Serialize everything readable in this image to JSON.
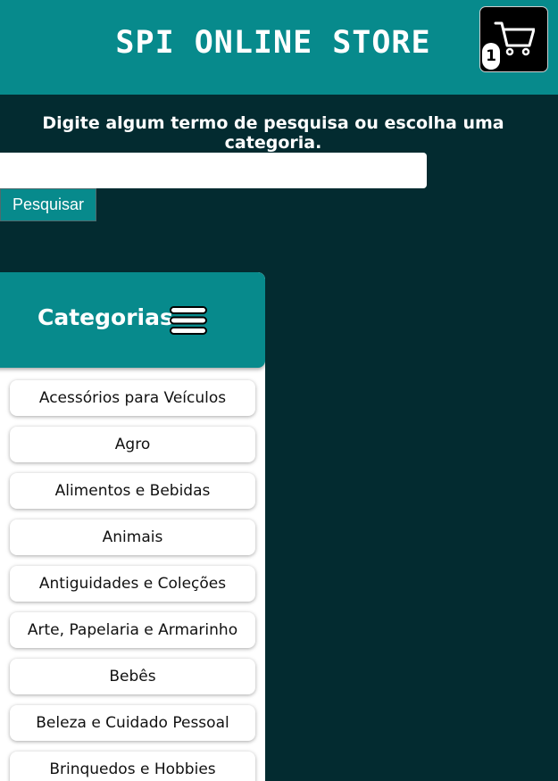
{
  "header": {
    "title": "SPI ONLINE STORE",
    "cart_count": "1",
    "background": "#078a8c"
  },
  "search": {
    "prompt": "Digite algum termo de pesquisa ou escolha uma categoria.",
    "value": "",
    "button_label": "Pesquisar"
  },
  "categories": {
    "title": "Categorias",
    "items": [
      {
        "label": "Acessórios para Veículos"
      },
      {
        "label": "Agro"
      },
      {
        "label": "Alimentos e Bebidas"
      },
      {
        "label": "Animais"
      },
      {
        "label": "Antiguidades e Coleções"
      },
      {
        "label": "Arte, Papelaria e Armarinho"
      },
      {
        "label": "Bebês"
      },
      {
        "label": "Beleza e Cuidado Pessoal"
      },
      {
        "label": "Brinquedos e Hobbies"
      }
    ]
  },
  "colors": {
    "background": "#032b30",
    "accent": "#078a8c"
  }
}
